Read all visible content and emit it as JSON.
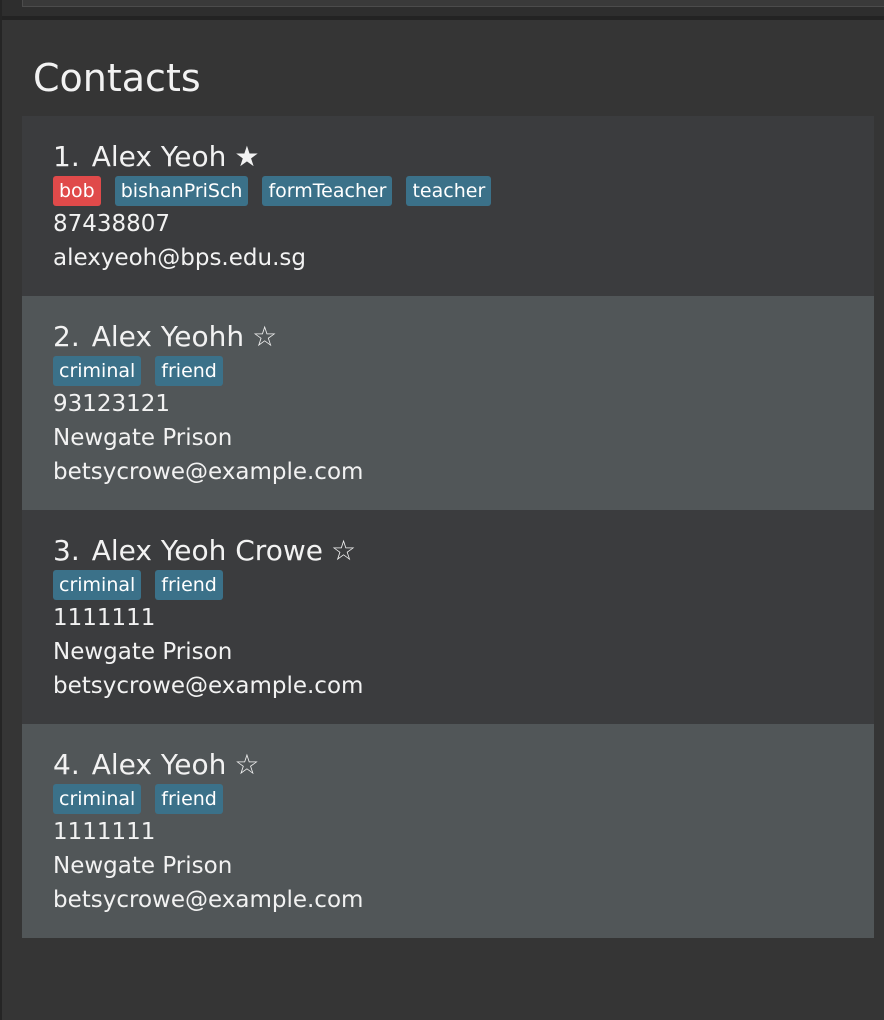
{
  "title": "Contacts",
  "contacts": [
    {
      "index": "1.",
      "name": "Alex Yeoh",
      "star": "★",
      "tags": [
        "bob",
        "bishanPriSch",
        "formTeacher",
        "teacher"
      ],
      "phone": "87438807",
      "address": "",
      "email": "alexyeoh@bps.edu.sg"
    },
    {
      "index": "2.",
      "name": "Alex Yeohh",
      "star": "☆",
      "tags": [
        "criminal",
        "friend"
      ],
      "phone": "93123121",
      "address": "Newgate Prison",
      "email": "betsycrowe@example.com"
    },
    {
      "index": "3.",
      "name": "Alex Yeoh Crowe",
      "star": "☆",
      "tags": [
        "criminal",
        "friend"
      ],
      "phone": "1111111",
      "address": "Newgate Prison",
      "email": "betsycrowe@example.com"
    },
    {
      "index": "4.",
      "name": "Alex Yeoh",
      "star": "☆",
      "tags": [
        "criminal",
        "friend"
      ],
      "phone": "1111111",
      "address": "Newgate Prison",
      "email": "betsycrowe@example.com"
    }
  ],
  "colors": {
    "background": "#353535",
    "card_odd": "#3b3c3e",
    "card_even": "#515658",
    "tag": "#3b7189",
    "tag_highlight": "#e04a4a",
    "text": "#f2f2f2"
  }
}
